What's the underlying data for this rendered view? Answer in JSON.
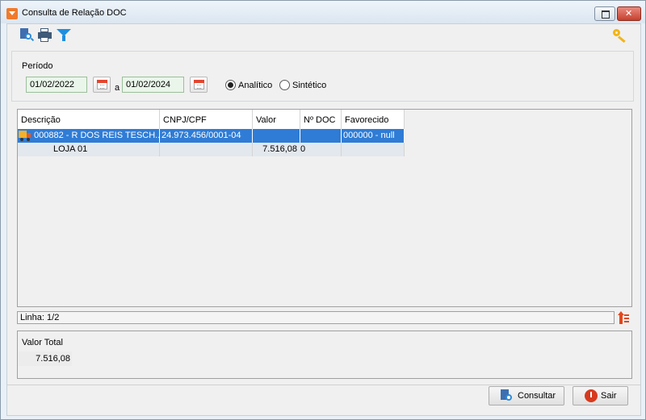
{
  "window": {
    "title": "Consulta de Relação DOC"
  },
  "toolbar": {
    "icons": [
      "search-document-icon",
      "print-icon",
      "filter-icon",
      "key-icon"
    ]
  },
  "period": {
    "label": "Período",
    "start_date": "01/02/2022",
    "separator": "a",
    "end_date": "01/02/2024",
    "modes": [
      {
        "label": "Analítico",
        "selected": true
      },
      {
        "label": "Sintético",
        "selected": false
      }
    ]
  },
  "grid": {
    "columns": [
      "Descrição",
      "CNPJ/CPF",
      "Valor",
      "Nº DOC",
      "Favorecido"
    ],
    "rows": [
      {
        "descricao": "000882 - R DOS REIS TESCH...",
        "cnpj": "24.973.456/0001-04",
        "valor": "",
        "ndoc": "",
        "favorecido": "000000 - null",
        "selected": true
      },
      {
        "descricao": "LOJA 01",
        "cnpj": "",
        "valor": "7.516,08",
        "ndoc": "0",
        "favorecido": ""
      }
    ]
  },
  "status": {
    "linha": "Linha: 1/2"
  },
  "totals": {
    "label": "Valor Total",
    "value": "7.516,08"
  },
  "buttons": {
    "consultar": "Consultar",
    "sair": "Sair"
  },
  "colors": {
    "selection": "#2f7cd6",
    "date_field_bg": "#eaf6ea",
    "accent_orange": "#f07a2b"
  }
}
